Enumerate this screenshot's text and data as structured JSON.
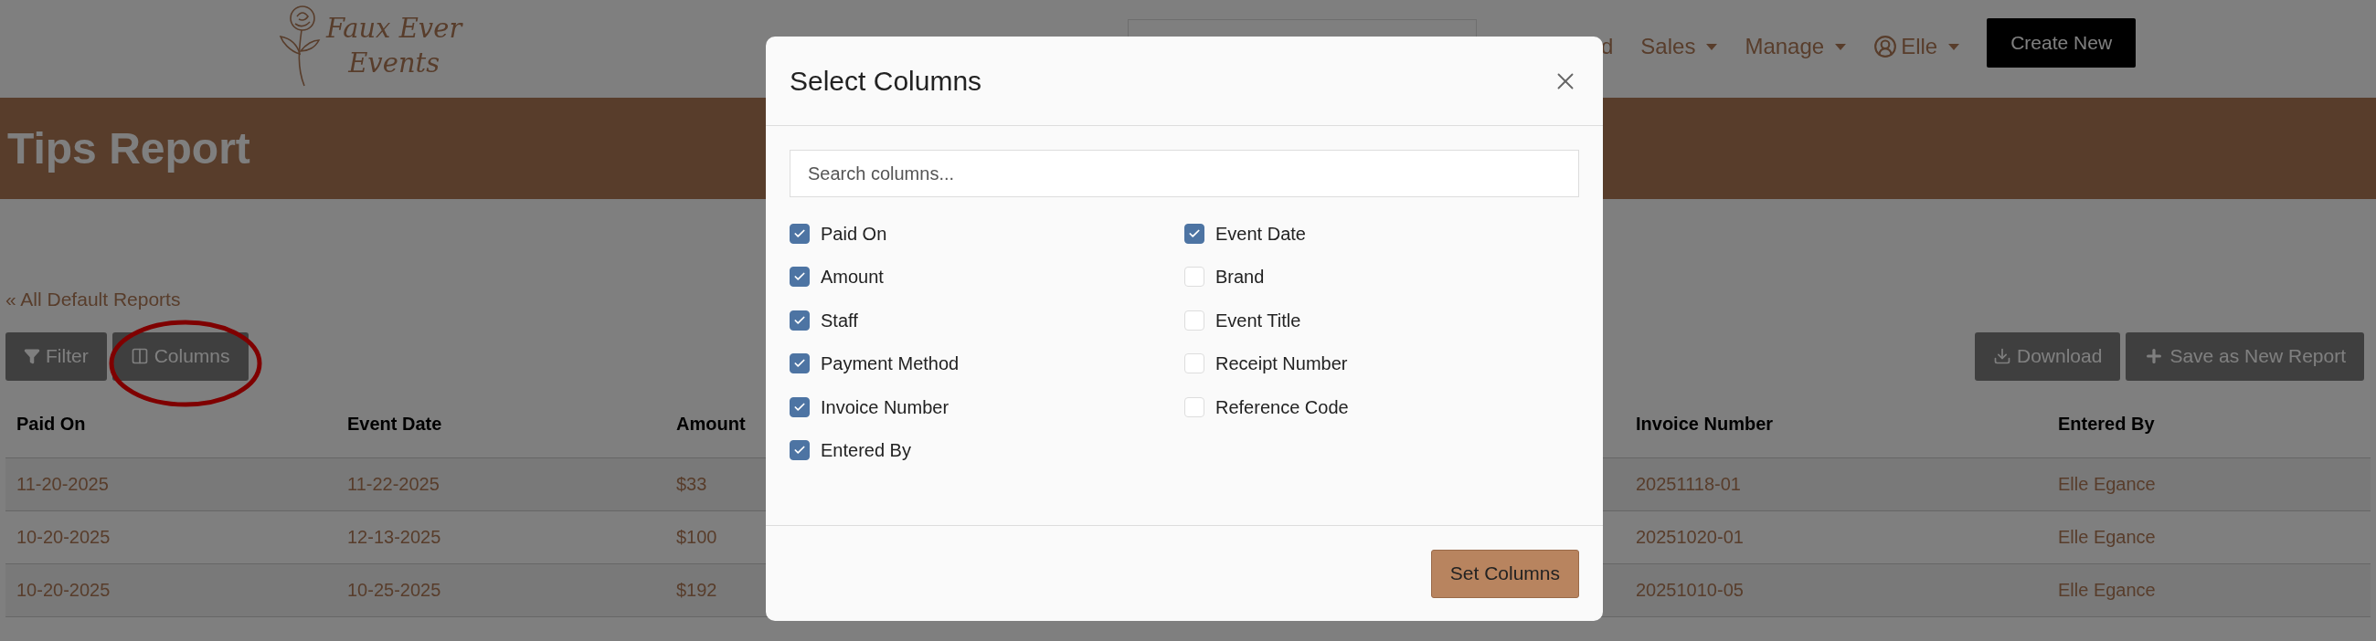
{
  "header": {
    "logo": {
      "line_1": "Faux Ever",
      "line_2": "Events"
    },
    "nav": [
      {
        "label": "d",
        "kind": "link"
      },
      {
        "label": "Sales",
        "kind": "menu"
      },
      {
        "label": "Manage",
        "kind": "menu"
      },
      {
        "label": "Elle",
        "kind": "user"
      }
    ],
    "create_button": "Create New"
  },
  "banner": {
    "title": "Tips Report"
  },
  "back_link": "« All Default Reports",
  "left_buttons": [
    {
      "kind": "filter",
      "label": "Filter"
    },
    {
      "kind": "columns",
      "label": "Columns"
    }
  ],
  "right_buttons": [
    {
      "kind": "download",
      "label": "Download"
    },
    {
      "kind": "add",
      "label": "Save as New Report"
    }
  ],
  "table": {
    "columns": [
      "Paid On",
      "Event Date",
      "Amount",
      "Invoice Number",
      "Entered By"
    ],
    "rows": [
      [
        "11-20-2025",
        "11-22-2025",
        "$33",
        "20251118-01",
        "Elle Egance"
      ],
      [
        "10-20-2025",
        "12-13-2025",
        "$100",
        "20251020-01",
        "Elle Egance"
      ],
      [
        "10-20-2025",
        "10-25-2025",
        "$192",
        "20251010-05",
        "Elle Egance"
      ]
    ]
  },
  "modal": {
    "title": "Select Columns",
    "search": {
      "placeholder": "Search columns..."
    },
    "option_columns": [
      {
        "options": [
          {
            "label": "Paid On",
            "checked": true
          },
          {
            "label": "Amount",
            "checked": true
          },
          {
            "label": "Staff",
            "checked": true
          },
          {
            "label": "Payment Method",
            "checked": true
          },
          {
            "label": "Invoice Number",
            "checked": true
          },
          {
            "label": "Entered By",
            "checked": true
          }
        ]
      },
      {
        "options": [
          {
            "label": "Event Date",
            "checked": true
          },
          {
            "label": "Brand",
            "checked": false
          },
          {
            "label": "Event Title",
            "checked": false
          },
          {
            "label": "Receipt Number",
            "checked": false
          },
          {
            "label": "Reference Code",
            "checked": false
          }
        ]
      }
    ],
    "submit_button": "Set Columns"
  }
}
